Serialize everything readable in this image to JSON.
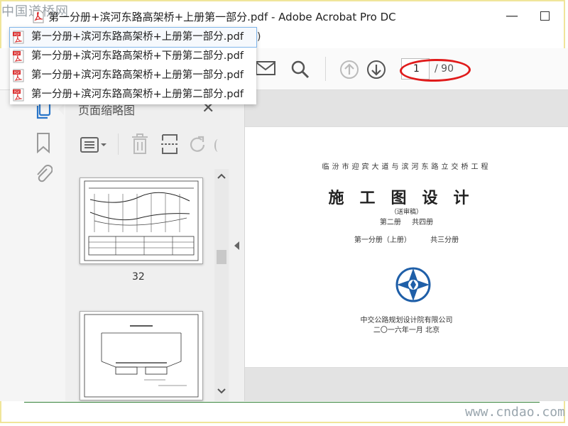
{
  "watermark_top": "中国道桥网",
  "title_bar": {
    "title": "第一分册+滨河东路高架桥+上册第一部分.pdf - Adobe Acrobat Pro DC"
  },
  "recent_files": [
    "第一分册+滨河东路高架桥+上册第一部分.pdf",
    "第一分册+滨河东路高架桥+下册第二部分.pdf",
    "第一分册+滨河东路高架桥+上册第一部分.pdf",
    "第一分册+滨河东路高架桥+上册第二部分.pdf"
  ],
  "menu_fragment": ")",
  "toolbar": {
    "page_current": "1",
    "page_total": "/ 90",
    "icons": [
      "mail-icon",
      "search-icon",
      "arrow-up-circle-icon",
      "arrow-down-circle-icon"
    ]
  },
  "nav_panel": {
    "title": "页面缩略图",
    "thumb_label": "32"
  },
  "document_page": {
    "project_line": "临汾市迎宾大道与滨河东路立交桥工程",
    "main_title": "施工图设计",
    "draft": "（送审稿）",
    "volume": "第二册 共四册",
    "book": "第一分册（上册） 共三分册",
    "organization": "中交公路规划设计院有限公司",
    "date": "二〇一六年一月 北京"
  },
  "colors": {
    "highlight_ellipse": "#e01b1b",
    "pdf_icon": "#d92b2b",
    "bottom_line": "#2e7d32",
    "accent_blue": "#2a76c9"
  },
  "watermark_bottom": "www.cndao.com"
}
